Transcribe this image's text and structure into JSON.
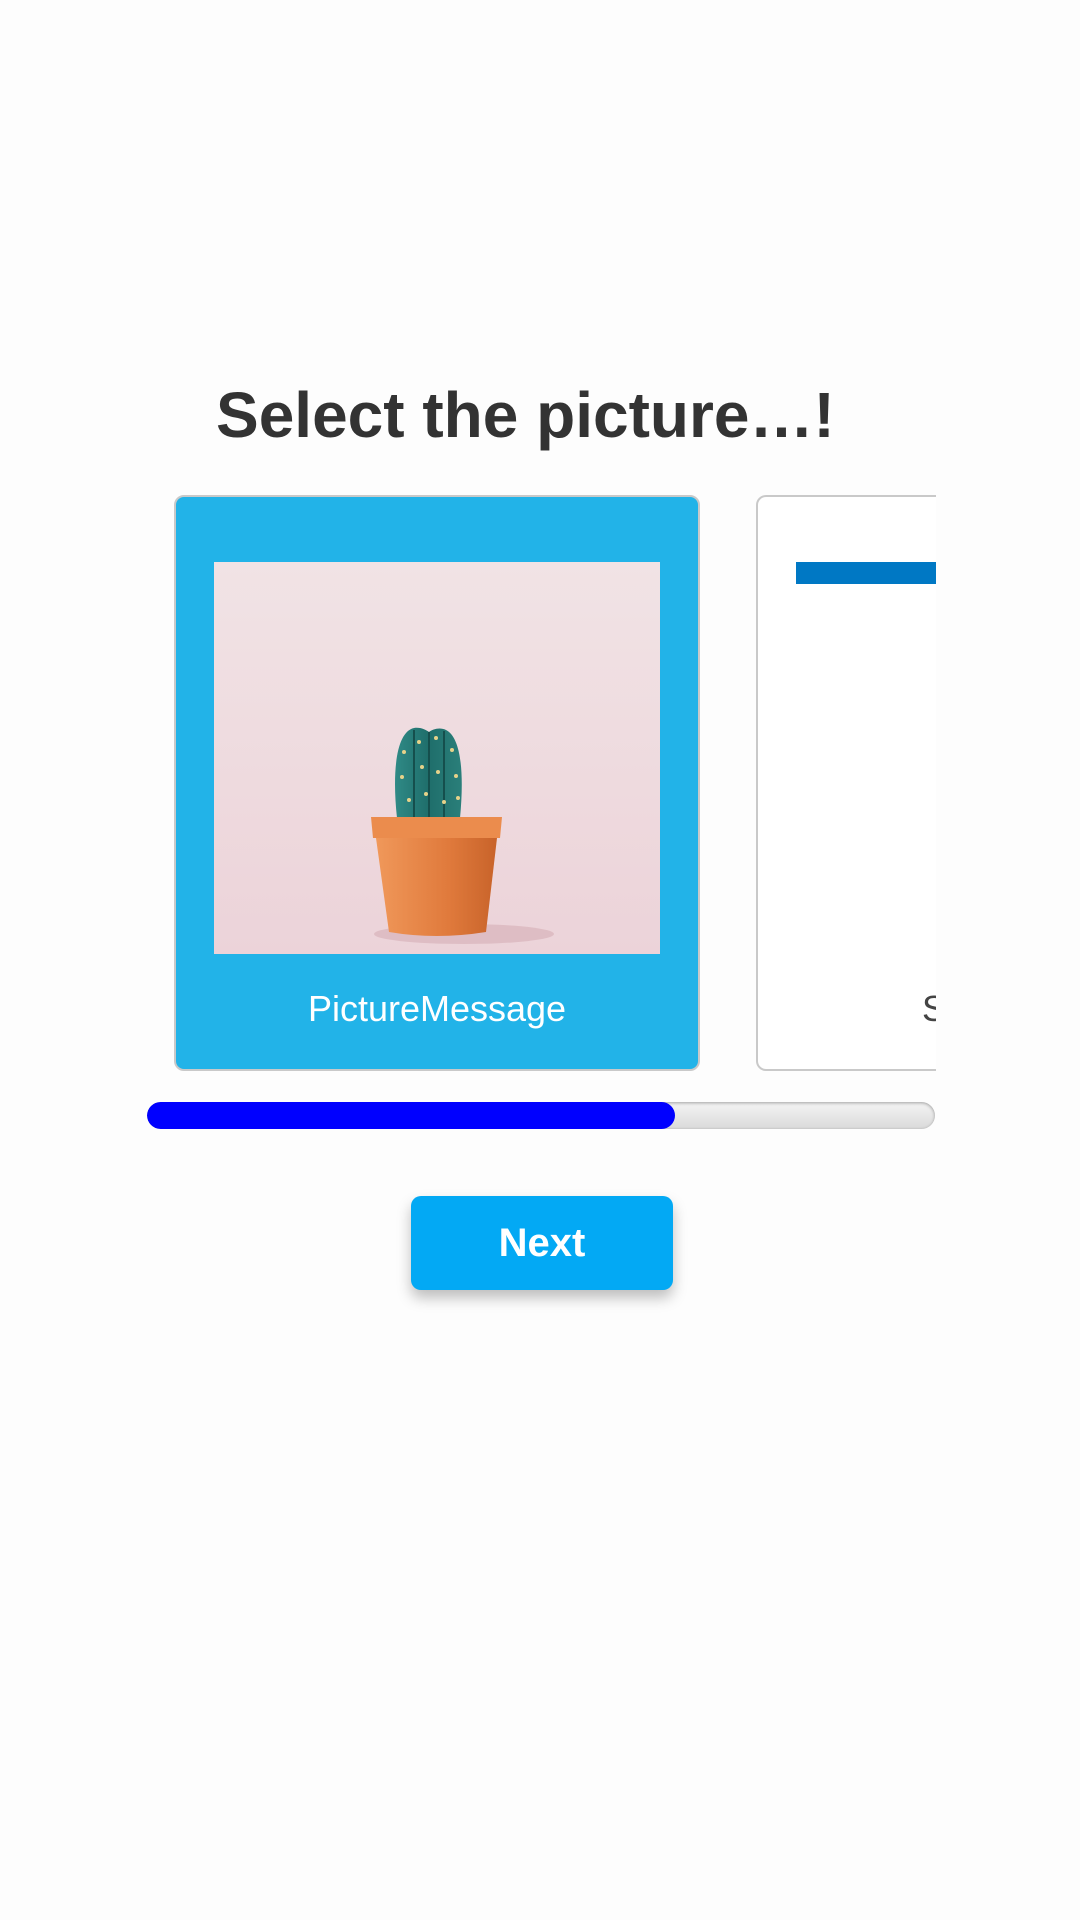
{
  "header": {
    "title": "Select the picture…!"
  },
  "cards": [
    {
      "label": "PictureMessage",
      "selected": true,
      "image": "cactus-photo"
    },
    {
      "label": "S",
      "selected": false,
      "image": "partially-visible-card"
    }
  ],
  "progress": {
    "fraction": 0.67
  },
  "actions": {
    "next_label": "Next"
  },
  "colors": {
    "selected_card": "#22b3e8",
    "progress_fill": "#0000ff",
    "button": "#03a9f4",
    "accent_bar": "#0078c4"
  }
}
